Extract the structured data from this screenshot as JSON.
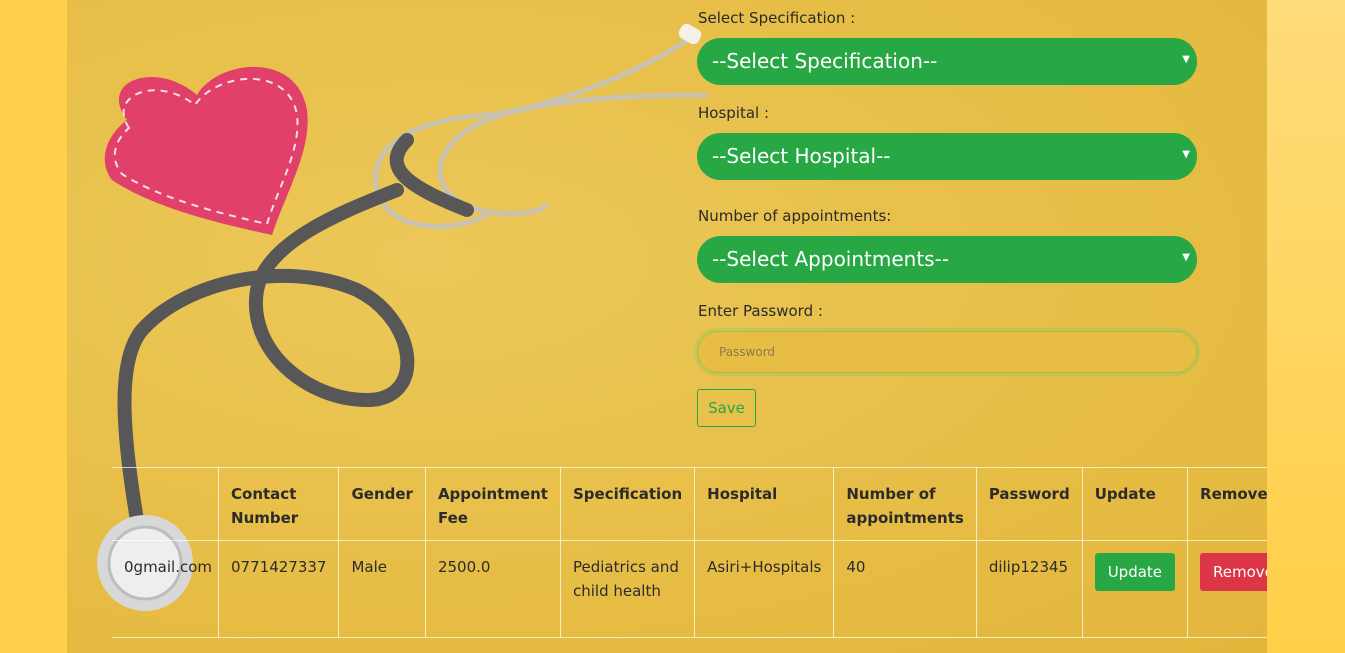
{
  "form": {
    "specification": {
      "label": "Select Specification :",
      "selected": "--Select Specification--"
    },
    "hospital": {
      "label": "Hospital :",
      "selected": "--Select Hospital--"
    },
    "appointments": {
      "label": "Number of appointments:",
      "selected": "--Select Appointments--"
    },
    "password": {
      "label": "Enter Password :",
      "placeholder": "Password"
    },
    "save_label": "Save"
  },
  "table": {
    "headers": [
      "",
      "Contact Number",
      "Gender",
      "Appointment Fee",
      "Specification",
      "Hospital",
      "Number of appointments",
      "Password",
      "Update",
      "Remove"
    ],
    "rows": [
      {
        "email": "0gmail.com",
        "contact": "0771427337",
        "gender": "Male",
        "fee": "2500.0",
        "specification": "Pediatrics and child health",
        "hospital": "Asiri+Hospitals",
        "appointments": "40",
        "password": "dilip12345",
        "update_label": "Update",
        "remove_label": "Remove"
      }
    ]
  },
  "colors": {
    "accent_green": "#28a745",
    "danger_red": "#dc3545",
    "background_yellow": "#e6bd45"
  },
  "icons": [
    "chevron-down-icon"
  ]
}
